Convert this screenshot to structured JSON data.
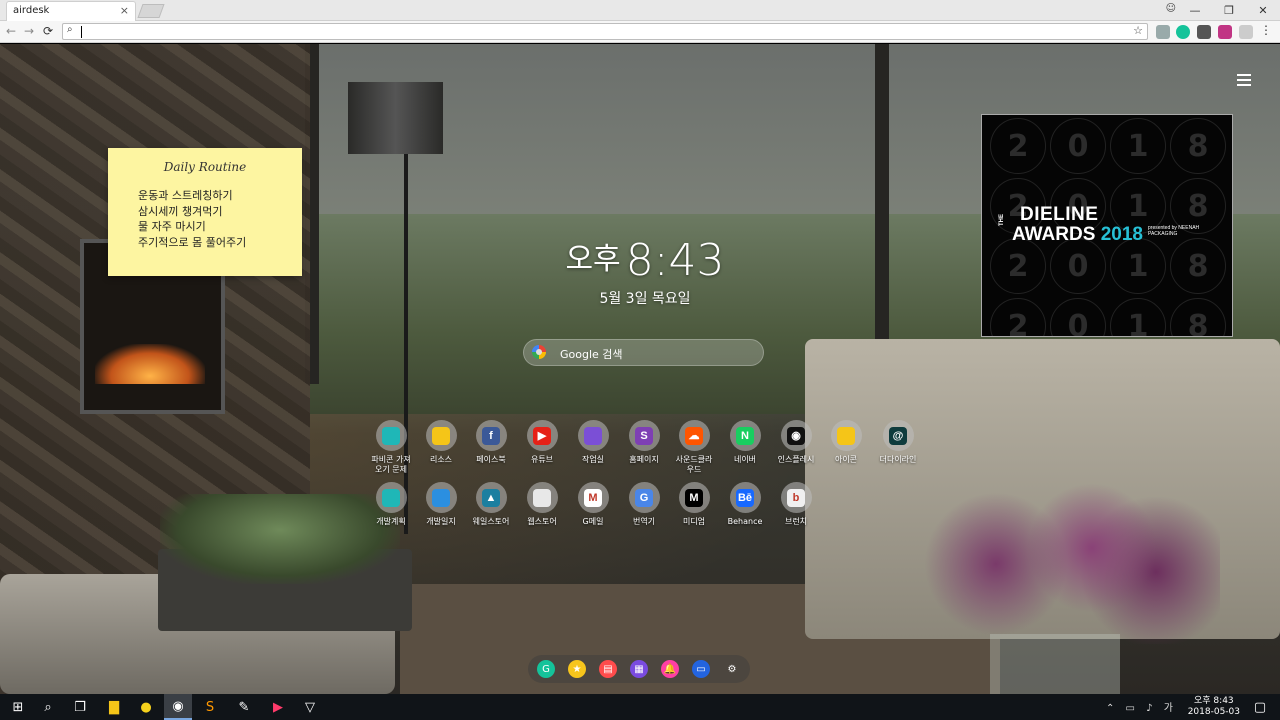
{
  "browser": {
    "tab_title": "airdesk",
    "tab_close": "×",
    "nav": {
      "back": "←",
      "forward": "→",
      "reload": "⟳"
    },
    "address_value": "",
    "window_controls": [
      "—",
      "❐",
      "✕"
    ]
  },
  "note": {
    "title": "Daily Routine",
    "items": [
      "운동과 스트레칭하기",
      "삼시세끼 챙겨먹기",
      "물 자주 마시기",
      "주기적으로 몸 풀어주기"
    ]
  },
  "clock": {
    "ampm": "오후",
    "time": "8:43",
    "date": "5월 3일 목요일"
  },
  "search": {
    "label": "Google 검색"
  },
  "widget": {
    "digits": [
      "2",
      "0",
      "1",
      "8",
      "2",
      "0",
      "1",
      "8",
      "2",
      "0",
      "1",
      "8",
      "2",
      "0",
      "1",
      "8"
    ],
    "the": "THE",
    "line1": "DIELINE",
    "line2": "AWARDS",
    "year": "2018",
    "sub": "presented by NEENAH PACKAGING"
  },
  "apps": [
    {
      "label": "파비콘 가져\n오기 문제",
      "icon": "teal-square-icon",
      "color": "#1fb7b7",
      "glyph": ""
    },
    {
      "label": "리소스",
      "icon": "folder-icon",
      "color": "#f5c518",
      "glyph": ""
    },
    {
      "label": "페이스북",
      "icon": "facebook-icon",
      "color": "#3b5998",
      "glyph": "f"
    },
    {
      "label": "유튜브",
      "icon": "youtube-icon",
      "color": "#e62117",
      "glyph": "▶"
    },
    {
      "label": "작업실",
      "icon": "workspace-icon",
      "color": "#7b4fd6",
      "glyph": ""
    },
    {
      "label": "홈페이지",
      "icon": "homepage-icon",
      "color": "#7e3fb4",
      "glyph": "S"
    },
    {
      "label": "사운드클라\n우드",
      "icon": "soundcloud-icon",
      "color": "#ff5500",
      "glyph": "☁"
    },
    {
      "label": "네이버",
      "icon": "naver-icon",
      "color": "#19ce60",
      "glyph": "N"
    },
    {
      "label": "인스플레시",
      "icon": "camera-icon",
      "color": "#111111",
      "glyph": "◉"
    },
    {
      "label": "아이콘",
      "icon": "folder-icon",
      "color": "#f5c518",
      "glyph": ""
    },
    {
      "label": "더다이라인",
      "icon": "dieline-icon",
      "color": "#0e3b3d",
      "glyph": "@"
    },
    {
      "label": "개발계획",
      "icon": "teal-square-icon",
      "color": "#1fb7b7",
      "glyph": ""
    },
    {
      "label": "개발일지",
      "icon": "blue-drop-icon",
      "color": "#2b8fe0",
      "glyph": ""
    },
    {
      "label": "웨일스토어",
      "icon": "whale-store-icon",
      "color": "#1b7fa0",
      "glyph": "▲"
    },
    {
      "label": "웹스토어",
      "icon": "chrome-webstore-icon",
      "color": "#e8e8e8",
      "glyph": ""
    },
    {
      "label": "G메일",
      "icon": "gmail-icon",
      "color": "#ffffff",
      "glyph": "M"
    },
    {
      "label": "번역기",
      "icon": "translate-icon",
      "color": "#4a86e8",
      "glyph": "G"
    },
    {
      "label": "미디엄",
      "icon": "medium-icon",
      "color": "#000000",
      "glyph": "M"
    },
    {
      "label": "Behance",
      "icon": "behance-icon",
      "color": "#1769ff",
      "glyph": "Bē"
    },
    {
      "label": "브런치",
      "icon": "brunch-icon",
      "color": "#f0f0f0",
      "glyph": "b"
    }
  ],
  "dock": [
    {
      "icon": "grammarly-icon",
      "color": "#15c39a",
      "glyph": "G"
    },
    {
      "icon": "star-icon",
      "color": "#f7c51c",
      "glyph": "★"
    },
    {
      "icon": "note-icon",
      "color": "#ff4c4c",
      "glyph": "▤"
    },
    {
      "icon": "calendar-icon",
      "color": "#7a4be0",
      "glyph": "▦"
    },
    {
      "icon": "bell-icon",
      "color": "#ff3fa4",
      "glyph": "🔔"
    },
    {
      "icon": "monitor-icon",
      "color": "#2364e0",
      "glyph": "▭"
    },
    {
      "icon": "gear-icon",
      "color": "transparent",
      "glyph": "⚙"
    }
  ],
  "taskbar": {
    "tray_time": "오후 8:43",
    "tray_date": "2018-05-03",
    "ime": "가"
  }
}
